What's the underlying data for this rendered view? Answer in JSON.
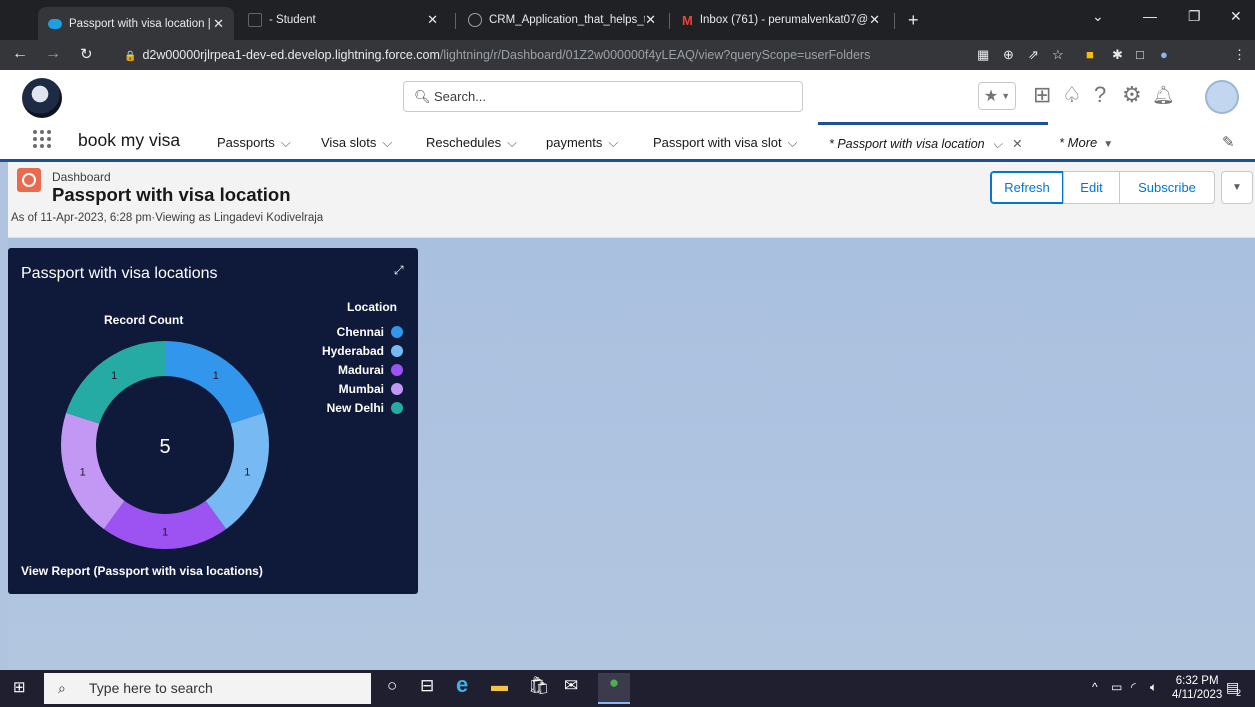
{
  "browser": {
    "tabs": [
      {
        "title": "Passport with visa location | Sales",
        "favicon": "salesforce-cloud-icon",
        "favicon_color": "#1ea0e0"
      },
      {
        "title": "- Student",
        "favicon": "page-icon",
        "favicon_color": "#5f6368"
      },
      {
        "title": "CRM_Application_that_helps_to_",
        "favicon": "globe-icon",
        "favicon_color": "#9aa0a6"
      },
      {
        "title": "Inbox (761) - perumalvenkat07@",
        "favicon": "gmail-icon",
        "favicon_color": "#ea4335"
      }
    ],
    "new_tab": "+",
    "url_host": "d2w00000rjlrpea1-dev-ed.develop.lightning.force.com",
    "url_path": "/lightning/r/Dashboard/01Z2w000000f4yLEAQ/view?queryScope=userFolders"
  },
  "header": {
    "search_placeholder": "Search..."
  },
  "nav": {
    "app_name": "book my visa",
    "items": [
      {
        "label": "Passports"
      },
      {
        "label": "Visa slots"
      },
      {
        "label": "Reschedules"
      },
      {
        "label": "payments"
      },
      {
        "label": "Passport with visa slot"
      }
    ],
    "active_tab": "* Passport with visa location",
    "more": "* More"
  },
  "dashboard": {
    "type_label": "Dashboard",
    "title": "Passport with visa location",
    "meta": "As of 11-Apr-2023, 6:28 pm·Viewing as Lingadevi Kodivelraja",
    "buttons": {
      "refresh": "Refresh",
      "edit": "Edit",
      "subscribe": "Subscribe"
    }
  },
  "widget": {
    "title": "Passport with visa locations",
    "footer": "View Report (Passport with visa locations)"
  },
  "chart_data": {
    "type": "pie",
    "title": "Record Count",
    "center_total": "5",
    "legend_title": "Location",
    "categories": [
      "Chennai",
      "Hyderabad",
      "Madurai",
      "Mumbai",
      "New Delhi"
    ],
    "values": [
      1,
      1,
      1,
      1,
      1
    ],
    "colors": [
      "#3296ed",
      "#77b9f2",
      "#9d53f2",
      "#c398f5",
      "#26aba4"
    ],
    "legend_position": "right"
  },
  "taskbar": {
    "search_placeholder": "Type here to search",
    "time": "6:32 PM",
    "date": "4/11/2023",
    "notif_count": "2"
  }
}
